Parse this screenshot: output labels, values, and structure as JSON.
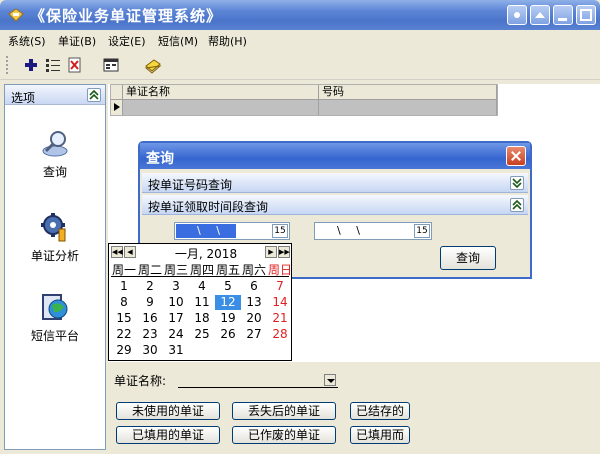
{
  "window": {
    "title": "《保险业务单证管理系统》"
  },
  "menu": [
    "系统(S)",
    "单证(B)",
    "设定(E)",
    "短信(M)",
    "帮助(H)"
  ],
  "left_panel": {
    "header": "选项",
    "items": [
      {
        "label": "查询",
        "icon": "magnifier-icon"
      },
      {
        "label": "单证分析",
        "icon": "gear-analysis-icon"
      },
      {
        "label": "短信平台",
        "icon": "globe-phone-icon"
      }
    ]
  },
  "grid": {
    "columns": [
      "单证名称",
      "号码"
    ]
  },
  "dialog": {
    "title": "查询",
    "section1": "按单证号码查询",
    "section2": "按单证领取时间段查询",
    "date_from": "\\ \\",
    "date_to": "\\ \\",
    "cal_btn": "15",
    "query_label": "查询"
  },
  "calendar": {
    "month": "一月, 2018",
    "weekdays": [
      "周一",
      "周二",
      "周三",
      "周四",
      "周五",
      "周六",
      "周日"
    ],
    "weeks": [
      [
        "1",
        "2",
        "3",
        "4",
        "5",
        "6",
        "7"
      ],
      [
        "8",
        "9",
        "10",
        "11",
        "12",
        "13",
        "14"
      ],
      [
        "15",
        "16",
        "17",
        "18",
        "19",
        "20",
        "21"
      ],
      [
        "22",
        "23",
        "24",
        "25",
        "26",
        "27",
        "28"
      ],
      [
        "29",
        "30",
        "31",
        "",
        "",
        "",
        ""
      ]
    ],
    "selected": "12"
  },
  "bottom": {
    "name_label": "单证名称:",
    "buttons": [
      "未使用的单证",
      "丢失后的单证",
      "已结存的",
      "已填用的单证",
      "已作废的单证",
      "已填用而"
    ]
  }
}
